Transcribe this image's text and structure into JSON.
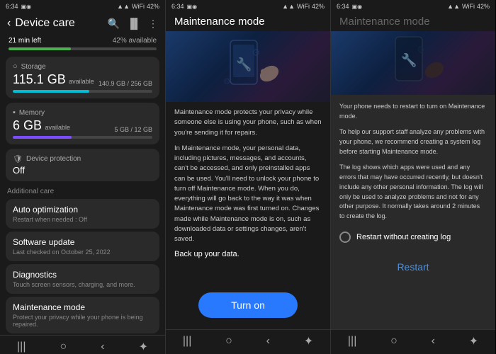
{
  "panels": [
    {
      "id": "panel1",
      "status": {
        "time": "6:34",
        "icons": "▣ ◉",
        "signal": "▲▲▲",
        "wifi": "WiFi",
        "battery": "42%"
      },
      "header": {
        "back": "‹",
        "title": "Device care",
        "search_icon": "🔍",
        "bar_icon": "▐▌",
        "more_icon": "⋮"
      },
      "battery_section": {
        "left": "21 min left",
        "right": "42% available",
        "progress": 42,
        "color": "#4caf50"
      },
      "storage": {
        "icon": "○",
        "label": "Storage",
        "value": "115.1 GB",
        "unit": "available",
        "right_label": "140.9 GB / 256 GB",
        "progress": 55,
        "color": "#00bcd4"
      },
      "memory": {
        "icon": "▪",
        "label": "Memory",
        "value": "6 GB",
        "unit": "available",
        "right_label": "5 GB / 12 GB",
        "progress": 42,
        "color": "#7c4dff"
      },
      "device_protection": {
        "icon": "🛡",
        "label": "Device protection",
        "value": "Off"
      },
      "additional_care_label": "Additional care",
      "list_items": [
        {
          "title": "Auto optimization",
          "sub": "Restart when needed : Off"
        },
        {
          "title": "Software update",
          "sub": "Last checked on October 25, 2022"
        },
        {
          "title": "Diagnostics",
          "sub": "Touch screen sensors, charging, and more."
        },
        {
          "title": "Maintenance mode",
          "sub": "Protect your privacy while your phone is being repaired."
        }
      ],
      "nav": [
        "|||",
        "○",
        "‹",
        "✦"
      ]
    },
    {
      "id": "panel2",
      "status": {
        "time": "6:34",
        "battery": "42%"
      },
      "header": {
        "title": "Maintenance mode"
      },
      "body_paragraphs": [
        "Maintenance mode protects your privacy while someone else is using your phone, such as when you're sending it for repairs.",
        "In Maintenance mode, your personal data, including pictures, messages, and accounts, can't be accessed, and only preinstalled apps can be used. You'll need to unlock your phone to turn off Maintenance mode. When you do, everything will go back to the way it was when Maintenance mode was first turned on. Changes made while Maintenance mode is on, such as downloaded data or settings changes, aren't saved."
      ],
      "backup_notice": "Back up your data.",
      "turn_on_label": "Turn on",
      "nav": [
        "|||",
        "○",
        "‹",
        "✦"
      ]
    },
    {
      "id": "panel3",
      "status": {
        "time": "6:34",
        "battery": "42%"
      },
      "header": {
        "title": "Maintenance mode"
      },
      "body_paragraphs": [
        "Your phone needs to restart to turn on Maintenance mode.",
        "To help our support staff analyze any problems with your phone, we recommend creating a system log before starting Maintenance mode.",
        "The log shows which apps were used and any errors that may have occurred recently, but doesn't include any other personal information. The log will only be used to analyze problems and not for any other purpose. It normally takes around 2 minutes to create the log."
      ],
      "radio_option": "Restart without creating log",
      "restart_label": "Restart",
      "nav": [
        "|||",
        "○",
        "‹",
        "✦"
      ]
    }
  ]
}
